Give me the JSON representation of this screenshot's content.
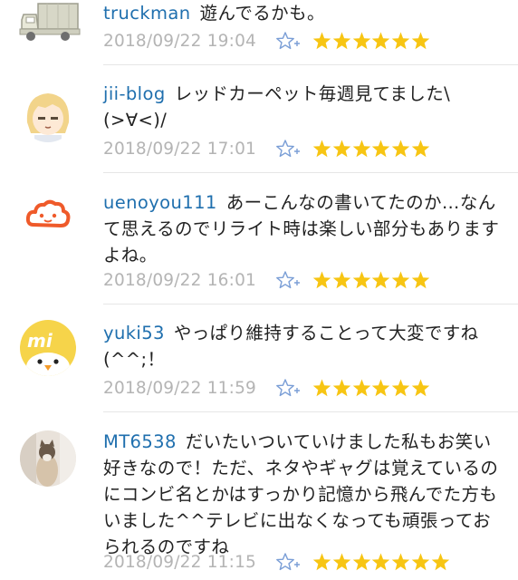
{
  "colors": {
    "username": "#1f6fae",
    "body_text": "#222222",
    "timestamp": "#b4b4b4",
    "star": "#f7c513",
    "add_star": "#7a9ed6"
  },
  "icons": {
    "add_star": "add-star-icon",
    "star": "yellow-star-icon"
  },
  "comments": [
    {
      "username": "truckman",
      "text": "遊んでるかも。",
      "timestamp": "2018/09/22 19:04",
      "stars": 6,
      "avatar": "truck-avatar"
    },
    {
      "username": "jii-blog",
      "text": "レッドカーペット毎週見てました\\ (>∀<)/",
      "timestamp": "2018/09/22 17:01",
      "stars": 6,
      "avatar": "anime-girl-avatar"
    },
    {
      "username": "uenoyou111",
      "text": "あーこんなの書いてたのか…なんて思えるのでリライト時は楽しい部分もありますよね。",
      "timestamp": "2018/09/22 16:01",
      "stars": 6,
      "avatar": "orange-cloud-avatar"
    },
    {
      "username": "yuki53",
      "text": "やっぱり維持することって大変ですね(^^;！",
      "timestamp": "2018/09/22 11:59",
      "stars": 6,
      "avatar": "yellow-bird-avatar"
    },
    {
      "username": "MT6538",
      "text": "だいたいついていけました私もお笑い好きなので！ただ、ネタやギャグは覚えているのにコンビ名とかはすっかり記憶から飛んでた方もいました^^テレビに出なくなっても頑張っておられるのですね",
      "timestamp": "2018/09/22 11:15",
      "stars": 7,
      "avatar": "cat-photo-avatar"
    }
  ]
}
